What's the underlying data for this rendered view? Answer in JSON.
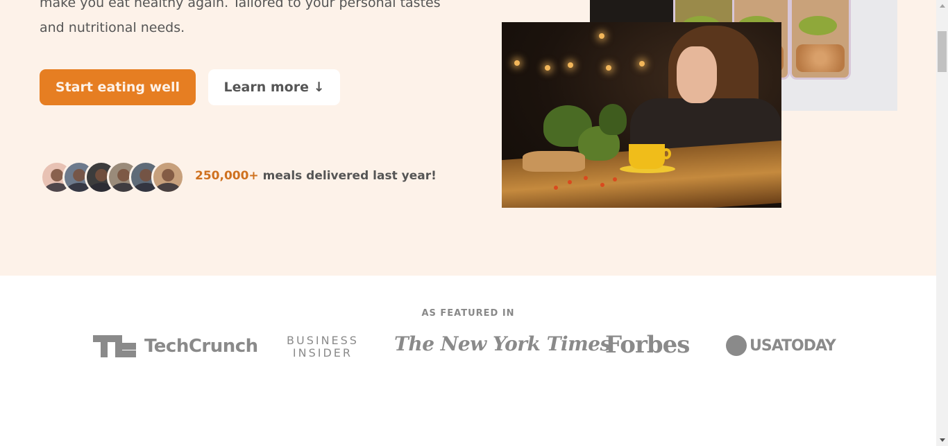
{
  "hero": {
    "description_line1": "make you eat healthy again. Tailored to your personal tastes",
    "description_line2": "and nutritional needs.",
    "cta_primary": "Start eating well",
    "cta_secondary": "Learn more ↓",
    "customers_highlight": "250,000+",
    "customers_text": " meals delivered last year!",
    "avatars": [
      "customer-1",
      "customer-2",
      "customer-3",
      "customer-4",
      "customer-5",
      "customer-6"
    ]
  },
  "featured": {
    "heading": "AS FEATURED IN",
    "logos": {
      "techcrunch": "TechCrunch",
      "business_insider_line1": "BUSINESS",
      "business_insider_line2": "INSIDER",
      "nyt": "The New York Times",
      "forbes": "Forbes",
      "usa_today": "USATODAY"
    }
  },
  "colors": {
    "hero_bg": "#fdf2e9",
    "primary": "#e67e22",
    "highlight": "#cf711f",
    "text": "#555555",
    "logo_gray": "#8a8a8a"
  }
}
